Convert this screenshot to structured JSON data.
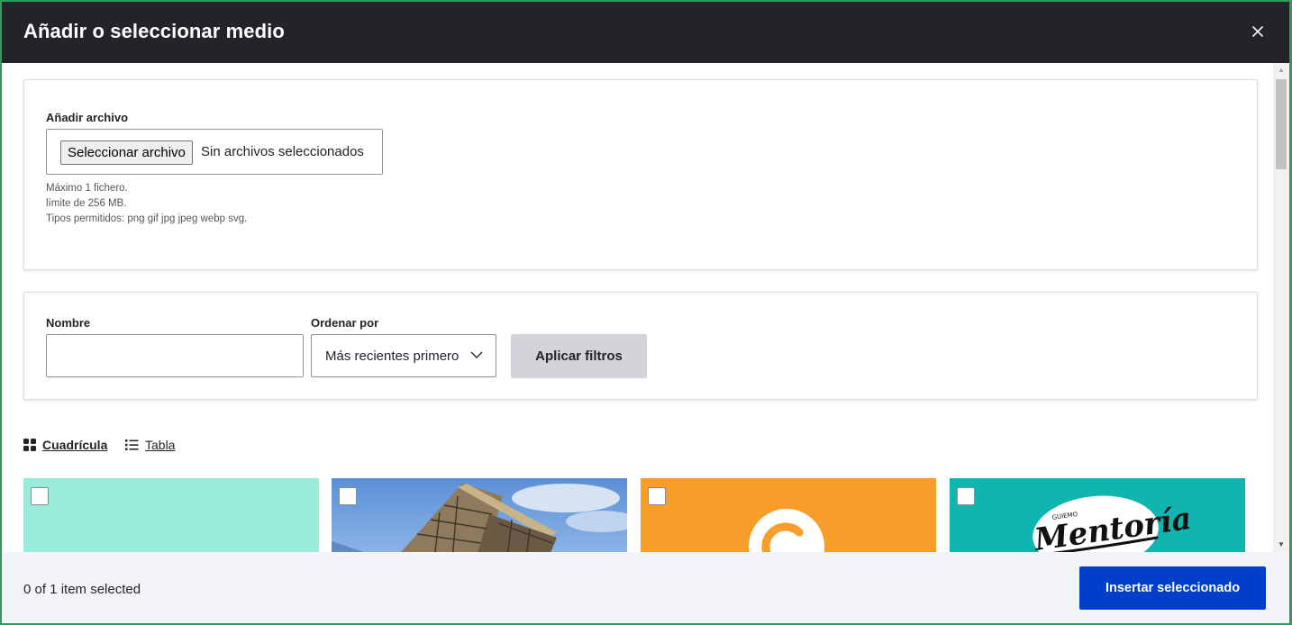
{
  "dialog": {
    "title": "Añadir o seleccionar medio"
  },
  "upload": {
    "label": "Añadir archivo",
    "button_label": "Seleccionar archivo",
    "status": "Sin archivos seleccionados",
    "help_lines": [
      "Máximo 1 fichero.",
      "límite de 256 MB.",
      "Tipos permitidos: png gif jpg jpeg webp svg."
    ]
  },
  "filters": {
    "name_label": "Nombre",
    "name_value": "",
    "sort_label": "Ordenar por",
    "sort_selected": "Más recientes primero",
    "apply_label": "Aplicar filtros"
  },
  "views": {
    "grid_label": "Cuadrícula",
    "table_label": "Tabla"
  },
  "media_items": [
    {
      "kind": "solid",
      "color": "#9aebd9"
    },
    {
      "kind": "building"
    },
    {
      "kind": "logo-c",
      "color": "#f89d2a"
    },
    {
      "kind": "mentoria",
      "color": "#10b5b0",
      "small_text": "GUIEMO",
      "big_text": "Mentoría"
    }
  ],
  "footer": {
    "status": "0 of 1 item selected",
    "insert_label": "Insertar seleccionado"
  },
  "colors": {
    "titlebar": "#232429",
    "primary_button": "#003ecc"
  }
}
